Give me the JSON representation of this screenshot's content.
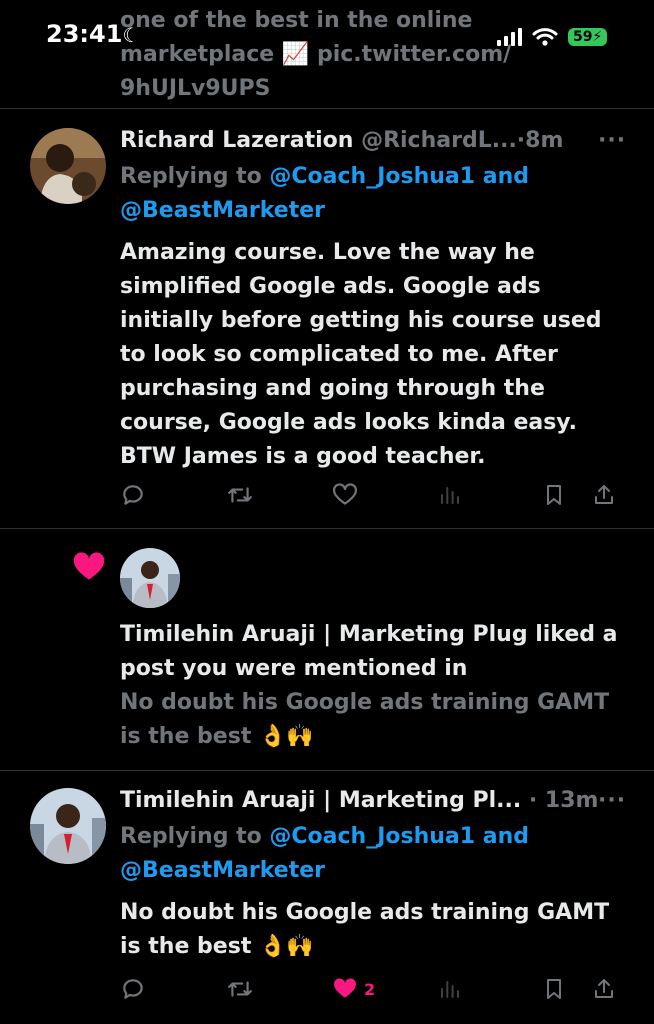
{
  "top_tweet": {
    "line1": "one of the best in the online",
    "line2_text": "marketplace",
    "line2_link": "pic.twitter.com/",
    "line3": "9hUJLv9UPS"
  },
  "status_bar": {
    "time": "23:41",
    "battery": "59"
  },
  "tweet1": {
    "name": "Richard Lazeration",
    "handle": "@RichardL...",
    "time": "8m",
    "replying_prefix": "Replying to",
    "mention1": "@Coach_Joshua1",
    "and": "and",
    "mention2": "@BeastMarketer",
    "body": "Amazing course. Love the way he simplified Google ads. Google ads initially before getting his course used to look so complicated to me. After purchasing and going through the course, Google ads looks kinda easy. BTW James is a good teacher."
  },
  "notification": {
    "text": "Timilehin Aruaji | Marketing Plug liked a post you were mentioned in",
    "snippet": "No doubt his Google ads training GAMT is the best",
    "emoji": "👌🙌"
  },
  "tweet2": {
    "name": "Timilehin Aruaji | Marketing Pl...",
    "time": "13m",
    "replying_prefix": "Replying to",
    "mention1": "@Coach_Joshua1",
    "and": "and",
    "mention2": "@BeastMarketer",
    "body": "No doubt his Google ads training GAMT is the best",
    "emoji": "👌🙌",
    "like_count": "2"
  },
  "colors": {
    "background": "#000000",
    "mention": "#1d9bf0",
    "like": "#f91880",
    "muted": "#71767b",
    "divider": "#2f3336"
  }
}
